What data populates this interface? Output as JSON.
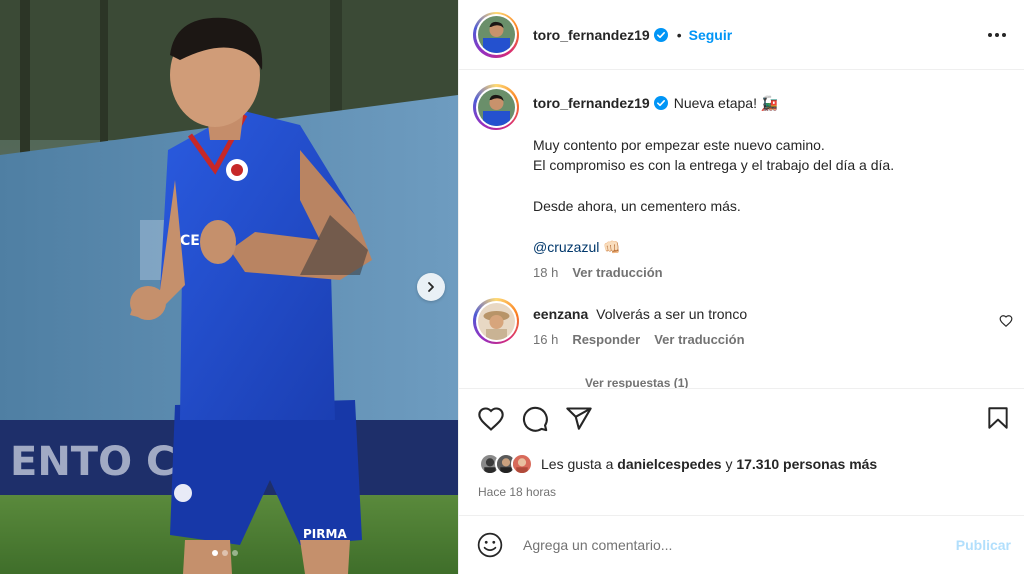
{
  "post": {
    "author": "toro_fernandez19",
    "follow_label": "Seguir",
    "bullet": "•",
    "caption": {
      "title": "Nueva etapa! 🚂",
      "line1": "Muy contento por empezar este nuevo camino.",
      "line2": "El compromiso es con la entrega y el trabajo del día a día.",
      "line3": "Desde ahora, un cementero más.",
      "mention": "@cruzazul",
      "mention_emoji": "👊🏻",
      "time": "18 h",
      "translate_label": "Ver traducción"
    },
    "comment": {
      "author": "eenzana",
      "text": "Volverás a ser un tronco",
      "time": "16 h",
      "reply_label": "Responder",
      "translate_label": "Ver traducción",
      "view_replies": "Ver respuestas (1)"
    },
    "likes": {
      "prefix": "Les gusta a ",
      "user": "danielcespedes",
      "middle": " y ",
      "count": "17.310 personas más"
    },
    "timestamp": "Hace 18 horas"
  },
  "add_comment": {
    "placeholder": "Agrega un comentario...",
    "publish_label": "Publicar"
  },
  "carousel": {
    "slide_count": 3,
    "active_index": 0
  },
  "colors": {
    "link": "#0095f6",
    "verified": "#0095f6",
    "publish_disabled": "#b2dffc",
    "jersey": "#1f49c7"
  },
  "icons": [
    "more-options-icon",
    "verified-icon",
    "heart-icon",
    "comment-icon",
    "share-icon",
    "bookmark-icon",
    "emoji-icon",
    "chevron-right-icon"
  ]
}
